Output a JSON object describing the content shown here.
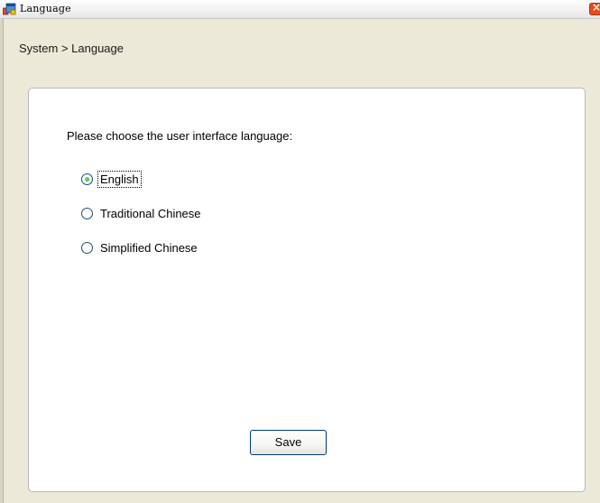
{
  "window": {
    "title": "Language"
  },
  "breadcrumb": "System > Language",
  "form": {
    "prompt": "Please choose the user interface language:",
    "options": [
      {
        "label": "English",
        "selected": true
      },
      {
        "label": "Traditional Chinese",
        "selected": false
      },
      {
        "label": "Simplified Chinese",
        "selected": false
      }
    ],
    "save_label": "Save"
  },
  "icons": {
    "app": "app-window-icon",
    "close": "close-icon"
  },
  "colors": {
    "window_bg": "#ece9d8",
    "panel_bg": "#ffffff",
    "radio_selected": "#21a121",
    "close_button": "#e64a19"
  }
}
